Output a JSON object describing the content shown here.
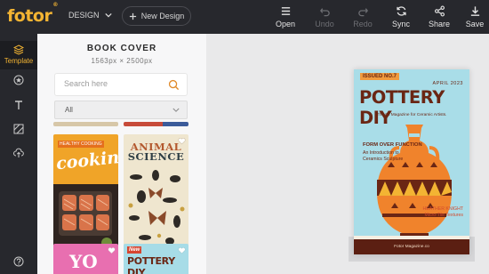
{
  "app": {
    "logo_text": "fotor",
    "logo_mark": "®"
  },
  "header": {
    "design_dropdown": "DESIGN",
    "new_design_label": "New Design",
    "toolbar": {
      "open": "Open",
      "undo": "Undo",
      "redo": "Redo",
      "sync": "Sync",
      "share": "Share",
      "save": "Save"
    }
  },
  "iconbar": {
    "items": [
      {
        "label": "Template",
        "icon": "layers-icon",
        "active": true
      },
      {
        "label": "",
        "icon": "star-circle-icon"
      },
      {
        "label": "",
        "icon": "text-icon"
      },
      {
        "label": "",
        "icon": "background-icon"
      },
      {
        "label": "",
        "icon": "upload-cloud-icon"
      },
      {
        "label": "",
        "icon": "help-icon"
      }
    ]
  },
  "panel": {
    "title": "BOOK COVER",
    "dimensions": "1563px × 2500px",
    "search_placeholder": "Search here",
    "filter_value": "All",
    "templates": [
      {
        "text": "cooking",
        "badge": "HEALTHY COOKING"
      },
      {
        "text_line1": "ANIMAL",
        "text_line2": "SCIENCE"
      },
      {
        "text": "YO"
      },
      {
        "badge": "New",
        "text": "POTTERY DIY"
      }
    ]
  },
  "preview": {
    "issue": "ISSUED NO.7",
    "date": "APRIL 2023",
    "title": "POTTERY DIY",
    "tagline": "The #1 Magazine for Ceramic Artists.",
    "feature_title": "FORM OVER FUNCTION",
    "feature_line1": "An Introduction to",
    "feature_line2": "Ceramics Sculpture",
    "author_name": "HEATHER KNIGHT",
    "author_line": "Micro-Tile Textures",
    "footer": "Fotor Magazine.co"
  },
  "colors": {
    "accent": "#f3b433",
    "topbar": "#27282d",
    "cover_bg": "#a9dde8",
    "cover_text": "#6a2614"
  }
}
